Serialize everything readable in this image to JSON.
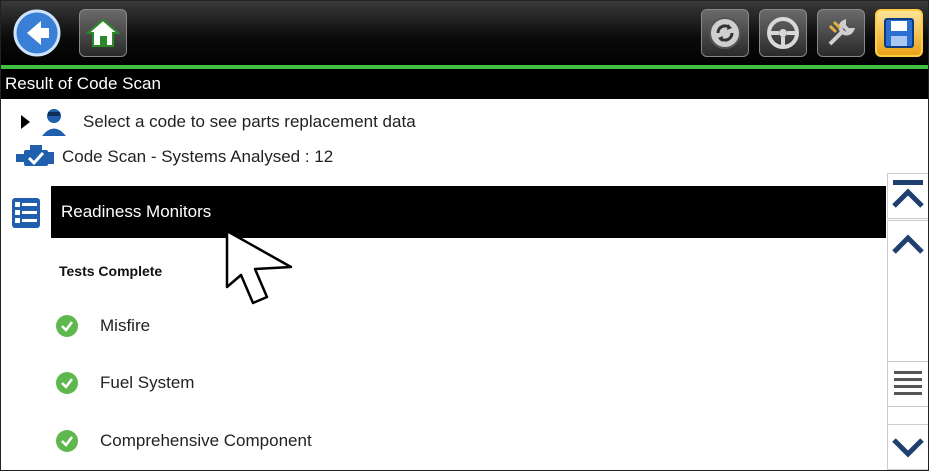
{
  "title_bar": {
    "text": "Result of Code Scan"
  },
  "info": {
    "parts_hint": "Select a code to see parts replacement data",
    "systems_analysed": "Code Scan - Systems Analysed : 12"
  },
  "monitor": {
    "header": "Readiness Monitors"
  },
  "tests": {
    "section_title": "Tests Complete",
    "items": [
      {
        "label": "Misfire",
        "status": "complete"
      },
      {
        "label": "Fuel System",
        "status": "complete"
      },
      {
        "label": "Comprehensive Component",
        "status": "complete"
      }
    ]
  },
  "toolbar": {
    "icons": [
      "back-icon",
      "home-icon",
      "sync-icon",
      "steering-wheel-icon",
      "tools-icon",
      "save-icon"
    ],
    "accent_color": "#3fbf3f",
    "active_button_color": "#e8a317"
  },
  "colors": {
    "check": "#5fb84e",
    "header_bg": "#000000"
  }
}
